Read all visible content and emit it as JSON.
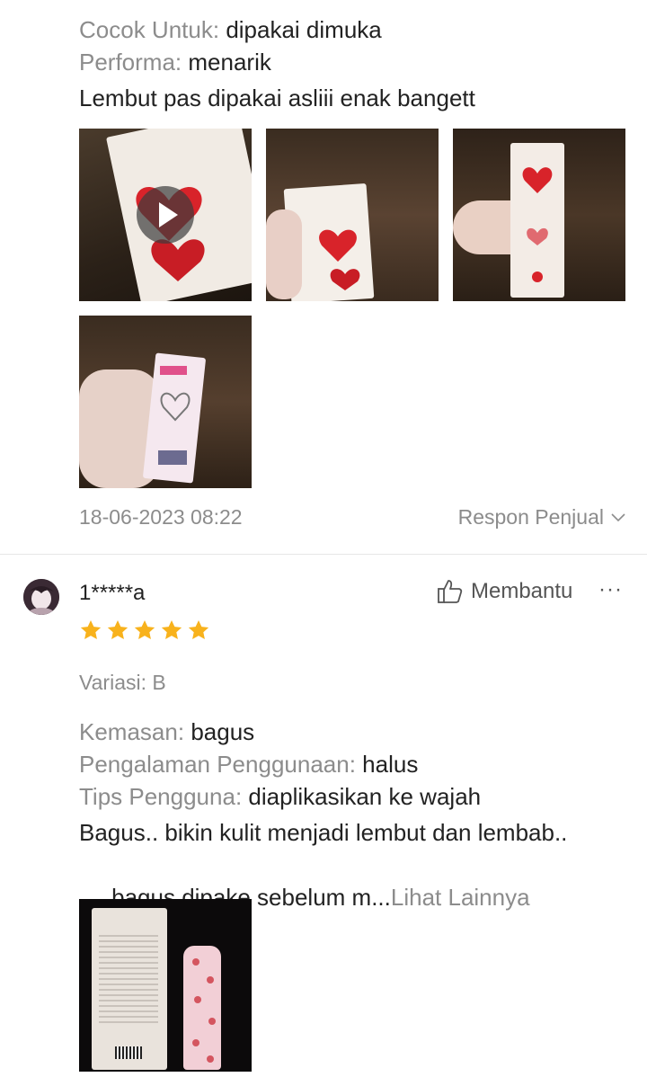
{
  "review1": {
    "attributes": [
      {
        "key": "Cocok Untuk:",
        "value": "dipakai dimuka"
      },
      {
        "key": "Performa:",
        "value": "menarik"
      }
    ],
    "text": "Lembut pas dipakai asliii enak bangett",
    "media": [
      {
        "kind": "video",
        "icon": "play-icon"
      },
      {
        "kind": "photo"
      },
      {
        "kind": "photo"
      },
      {
        "kind": "photo"
      }
    ],
    "timestamp": "18-06-2023 08:22",
    "seller_response_label": "Respon Penjual"
  },
  "review2": {
    "username": "1*****a",
    "helpful_label": "Membantu",
    "more_label": "···",
    "rating": 5,
    "variation": "Variasi: B",
    "attributes": [
      {
        "key": "Kemasan:",
        "value": "bagus"
      },
      {
        "key": "Pengalaman Penggunaan:",
        "value": "halus"
      },
      {
        "key": "Tips Pengguna:",
        "value": "diaplikasikan ke wajah"
      }
    ],
    "text_line1": "Bagus.. bikin kulit menjadi lembut dan lembab..",
    "text_line2": " bagus dipake sebelum m...",
    "see_more_label": "Lihat Lainnya"
  },
  "colors": {
    "star": "#f8b21c",
    "muted_text": "#8c8c8c",
    "divider": "#e6e6e6"
  }
}
